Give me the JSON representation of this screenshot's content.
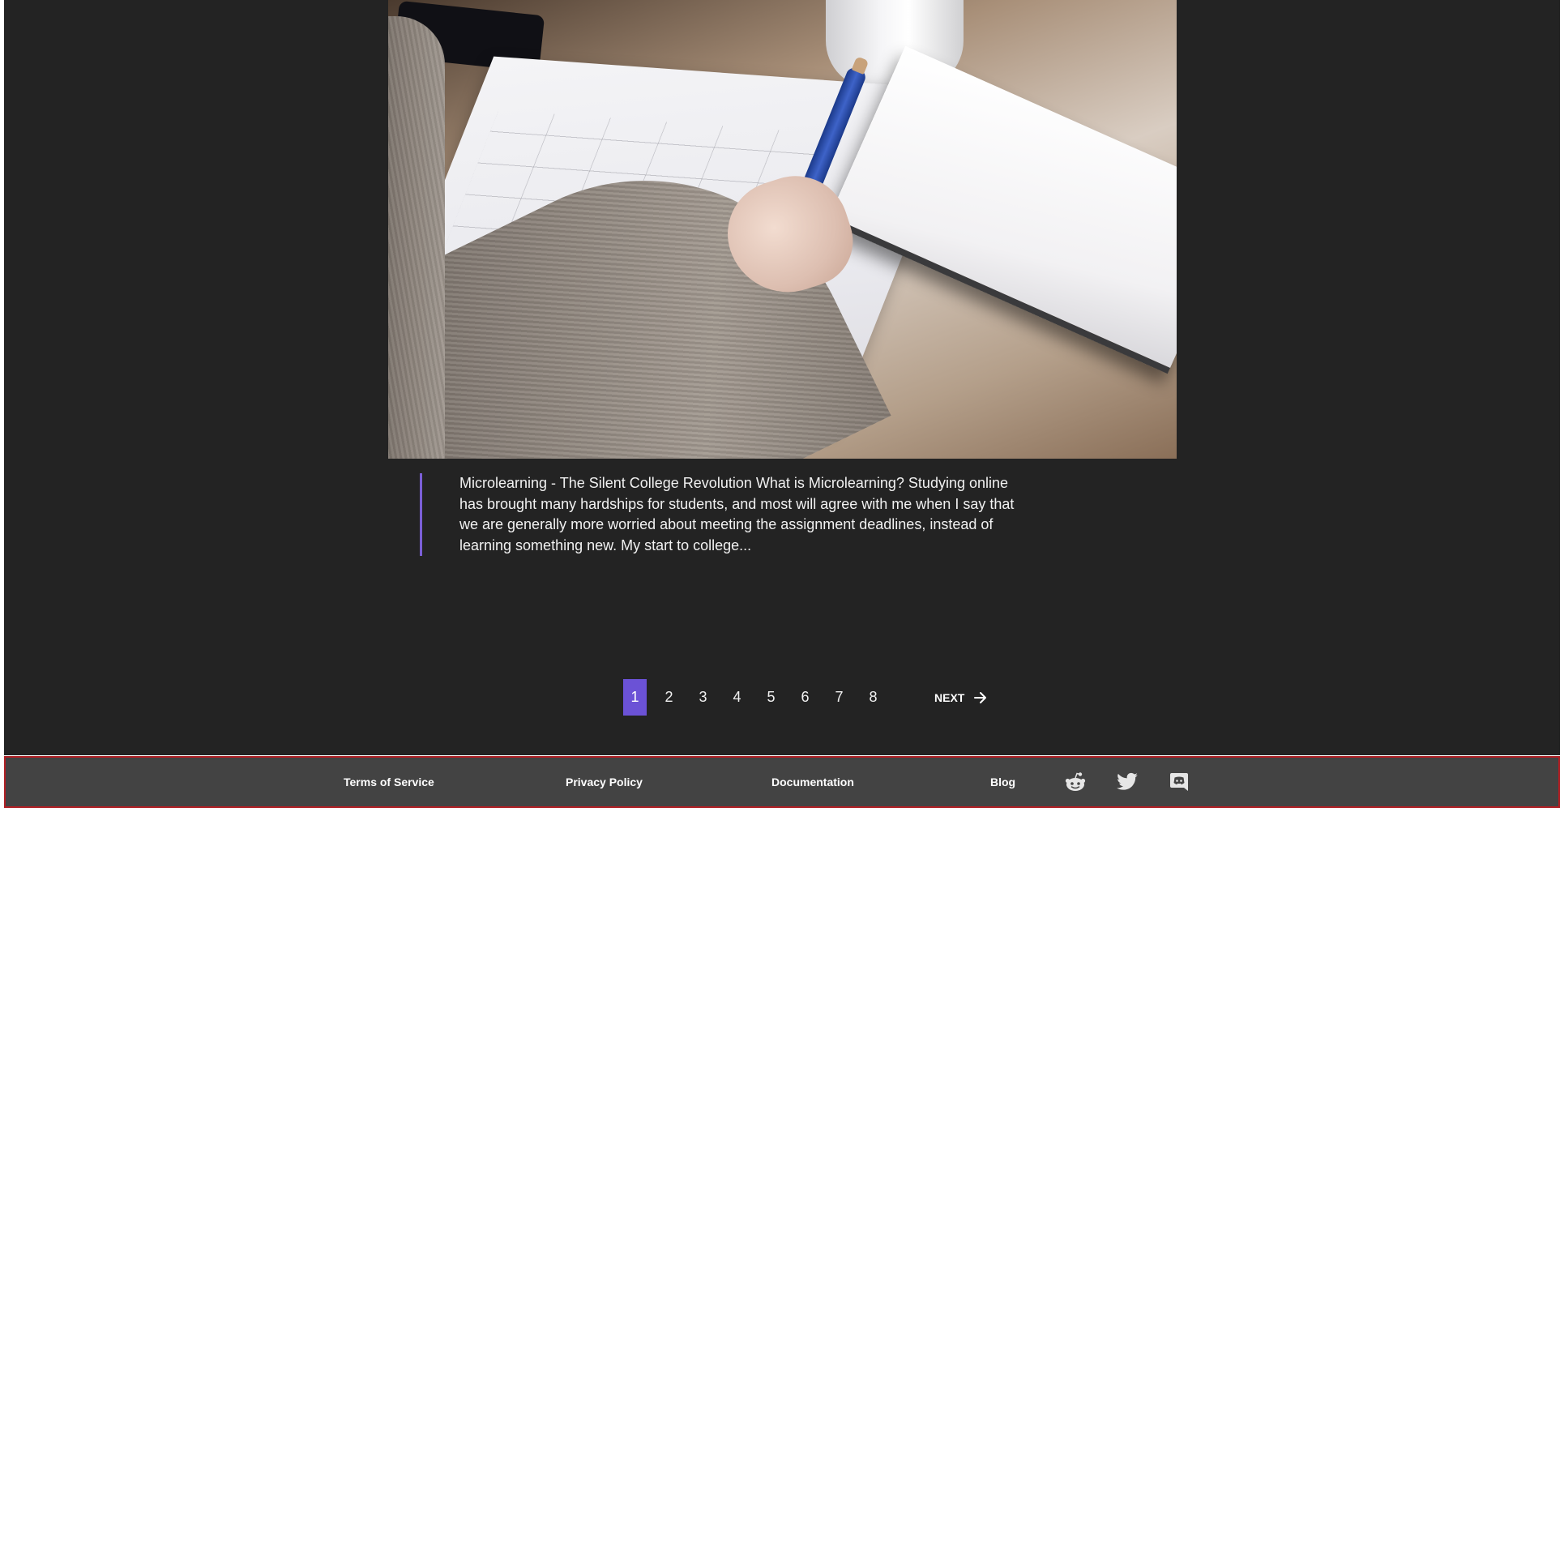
{
  "post": {
    "image_alt": "Person writing with a pen on papers at a wooden table",
    "excerpt": "Microlearning - The Silent College Revolution What is Microlearning? Studying online has brought many hardships for students, and most will agree with me when I say that we are generally more worried about meeting the assignment deadlines, instead of learning something new. My start to college..."
  },
  "pagination": {
    "pages": [
      "1",
      "2",
      "3",
      "4",
      "5",
      "6",
      "7",
      "8"
    ],
    "active_page": "1",
    "next_label": "NEXT"
  },
  "footer": {
    "links": {
      "terms": "Terms of Service",
      "privacy": "Privacy Policy",
      "docs": "Documentation",
      "blog": "Blog"
    },
    "social_icons": [
      "reddit-icon",
      "twitter-icon",
      "discord-icon"
    ]
  },
  "colors": {
    "background": "#232323",
    "accent": "#6b52d6",
    "footer_bg": "#434343",
    "footer_border": "#b01f24"
  }
}
